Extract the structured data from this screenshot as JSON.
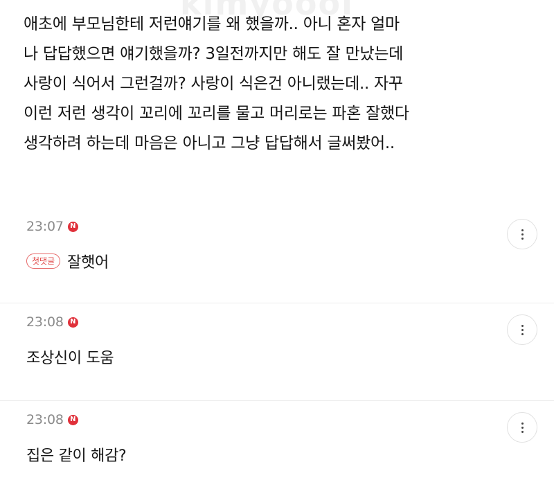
{
  "watermark": "kimyoooi",
  "post": {
    "lines": [
      "애초에 부모님한테 저런얘기를 왜 했을까.. 아니 혼자 얼마",
      "나 답답했으면 얘기했을까? 3일전까지만 해도 잘 만났는데",
      "사랑이 식어서 그런걸까? 사랑이 식은건 아니랬는데.. 자꾸",
      "이런 저런 생각이 꼬리에 꼬리를 물고 머리로는 파혼 잘했다",
      "생각하려 하는데 마음은 아니고 그냥 답답해서 글써봤어.."
    ]
  },
  "comments": [
    {
      "time": "23:07",
      "badge": "N",
      "first_label": "첫댓글",
      "text": "잘햇어",
      "menu_icon": "more-vertical-icon"
    },
    {
      "time": "23:08",
      "badge": "N",
      "text": "조상신이 도움",
      "menu_icon": "more-vertical-icon"
    },
    {
      "time": "23:08",
      "badge": "N",
      "text": "집은 같이 해감?",
      "menu_icon": "more-vertical-icon"
    }
  ],
  "colors": {
    "new_badge": "#e0303a",
    "first_badge": "#e04a4a",
    "time": "#8a8a8a"
  }
}
